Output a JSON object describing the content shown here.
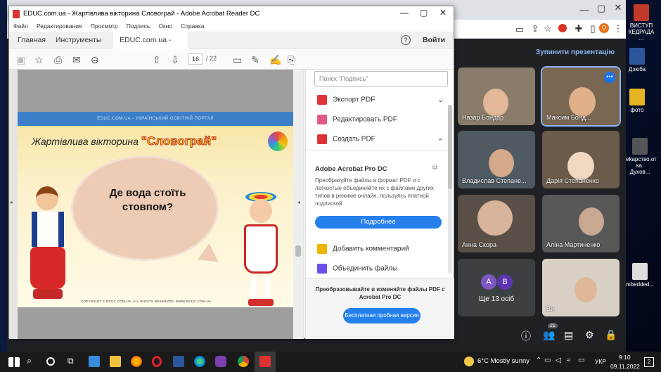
{
  "desktop": {
    "icons": [
      {
        "label": "ВИСТУП КЕДРАДА ...",
        "color": "#c0392b"
      },
      {
        "label": "Дзюба",
        "color": "#2b579a"
      },
      {
        "label": "фото",
        "color": "#e6b422"
      },
      {
        "label": "ekарство.от ка. Духов...",
        "color": "#3d3d3d"
      },
      {
        "label": "mbedded...",
        "color": "#ddd"
      }
    ]
  },
  "meet": {
    "present_label": "Зупинити презентацію",
    "participants": [
      {
        "name": "Назар Бондар",
        "bg": "#8a7c6a",
        "face": "#e2b898"
      },
      {
        "name": "Максим Бонд...",
        "bg": "#7a6752",
        "face": "#e0b08a"
      },
      {
        "name": "Владислав Степане...",
        "bg": "#4f5a62",
        "face": "#d4a888"
      },
      {
        "name": "Дарія Степаненко",
        "bg": "#6b5b4a",
        "face": "#f0d8c0"
      },
      {
        "name": "Анна Скора",
        "bg": "#5a5048",
        "face": "#d8b49a"
      },
      {
        "name": "Аліна Мартиненко",
        "bg": "#585858",
        "face": "#c8a890"
      },
      {
        "name": "Ще 13 осіб",
        "bg": "#3c4043",
        "face": ""
      },
      {
        "name": "Ви",
        "bg": "#d8d0c4",
        "face": "#e0b898"
      }
    ],
    "more_initials": [
      "A",
      "B"
    ],
    "participant_count": "21"
  },
  "acrobat": {
    "title": "EDUC.com.ua - Жартівлива вікторина Словограй - Adobe Acrobat Reader DC",
    "menu": [
      "Файл",
      "Редактирование",
      "Просмотр",
      "Подпись",
      "Окно",
      "Справка"
    ],
    "tabs": {
      "home": "Главная",
      "tools": "Инструменты",
      "doc": "EDUC.com.ua - Жа...",
      "signin": "Войти"
    },
    "page": {
      "current": "16",
      "total": "/ 22"
    },
    "slide": {
      "header": "EDUC.COM.UA - УКРАЇНСЬКИЙ ОСВІТНІЙ ПОРТАЛ",
      "title": "Жартівлива вікторина",
      "title_word": "\"Словограй\"",
      "question": "Де вода стоїть стовпом?",
      "copyright": "COPYRIGHT © EDUC.COM.UA. ALL RIGHTS RESERVED. WWW.EDUC.COM.UA"
    },
    "panel": {
      "search_placeholder": "Поиск \"Подпись\"",
      "tools": [
        {
          "label": "Экспорт PDF",
          "color": "#d33",
          "chev": "⌄"
        },
        {
          "label": "Редактировать PDF",
          "color": "#e05a8a",
          "chev": ""
        },
        {
          "label": "Создать PDF",
          "color": "#d33",
          "chev": "⌃"
        }
      ],
      "promo_title": "Adobe Acrobat Pro DC",
      "promo_text": "Преобразуйте файлы в формат PDF и с легкостью объединяйте их с файлами других типов в режиме онлайн, пользуясь платной подпиской",
      "promo_button": "Подробнее",
      "tools2": [
        {
          "label": "Добавить комментарий",
          "color": "#f0b400"
        },
        {
          "label": "Объединить файлы",
          "color": "#6b4ee6"
        }
      ],
      "bottom_text": "Преобразовывайте и изменяйте файлы PDF с Acrobat Pro DC",
      "trial_button": "Бесплатная пробная версия"
    }
  },
  "taskbar": {
    "weather": "6°C  Mostly sunny",
    "lang": "УКР",
    "time": "9:10",
    "date": "09.11.2022",
    "notif": "2"
  }
}
